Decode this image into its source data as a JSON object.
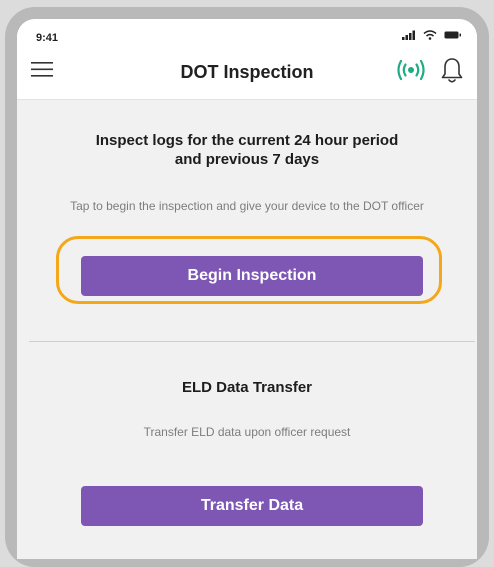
{
  "status_bar": {
    "time": "9:41"
  },
  "header": {
    "title": "DOT Inspection",
    "menu_icon": "hamburger-menu-icon",
    "connection_icon": "broadcast-signal-icon",
    "notification_icon": "bell-icon"
  },
  "inspection": {
    "heading_line1": "Inspect logs for the current 24 hour period",
    "heading_line2": "and previous 7 days",
    "description": "Tap to begin the inspection and give your device to the DOT officer",
    "button_label": "Begin Inspection"
  },
  "data_transfer": {
    "heading": "ELD Data Transfer",
    "description": "Transfer ELD data upon officer request",
    "button_label": "Transfer Data"
  },
  "colors": {
    "accent_purple": "#7e57b5",
    "highlight_orange": "#f4a819",
    "signal_green": "#1fab83"
  }
}
